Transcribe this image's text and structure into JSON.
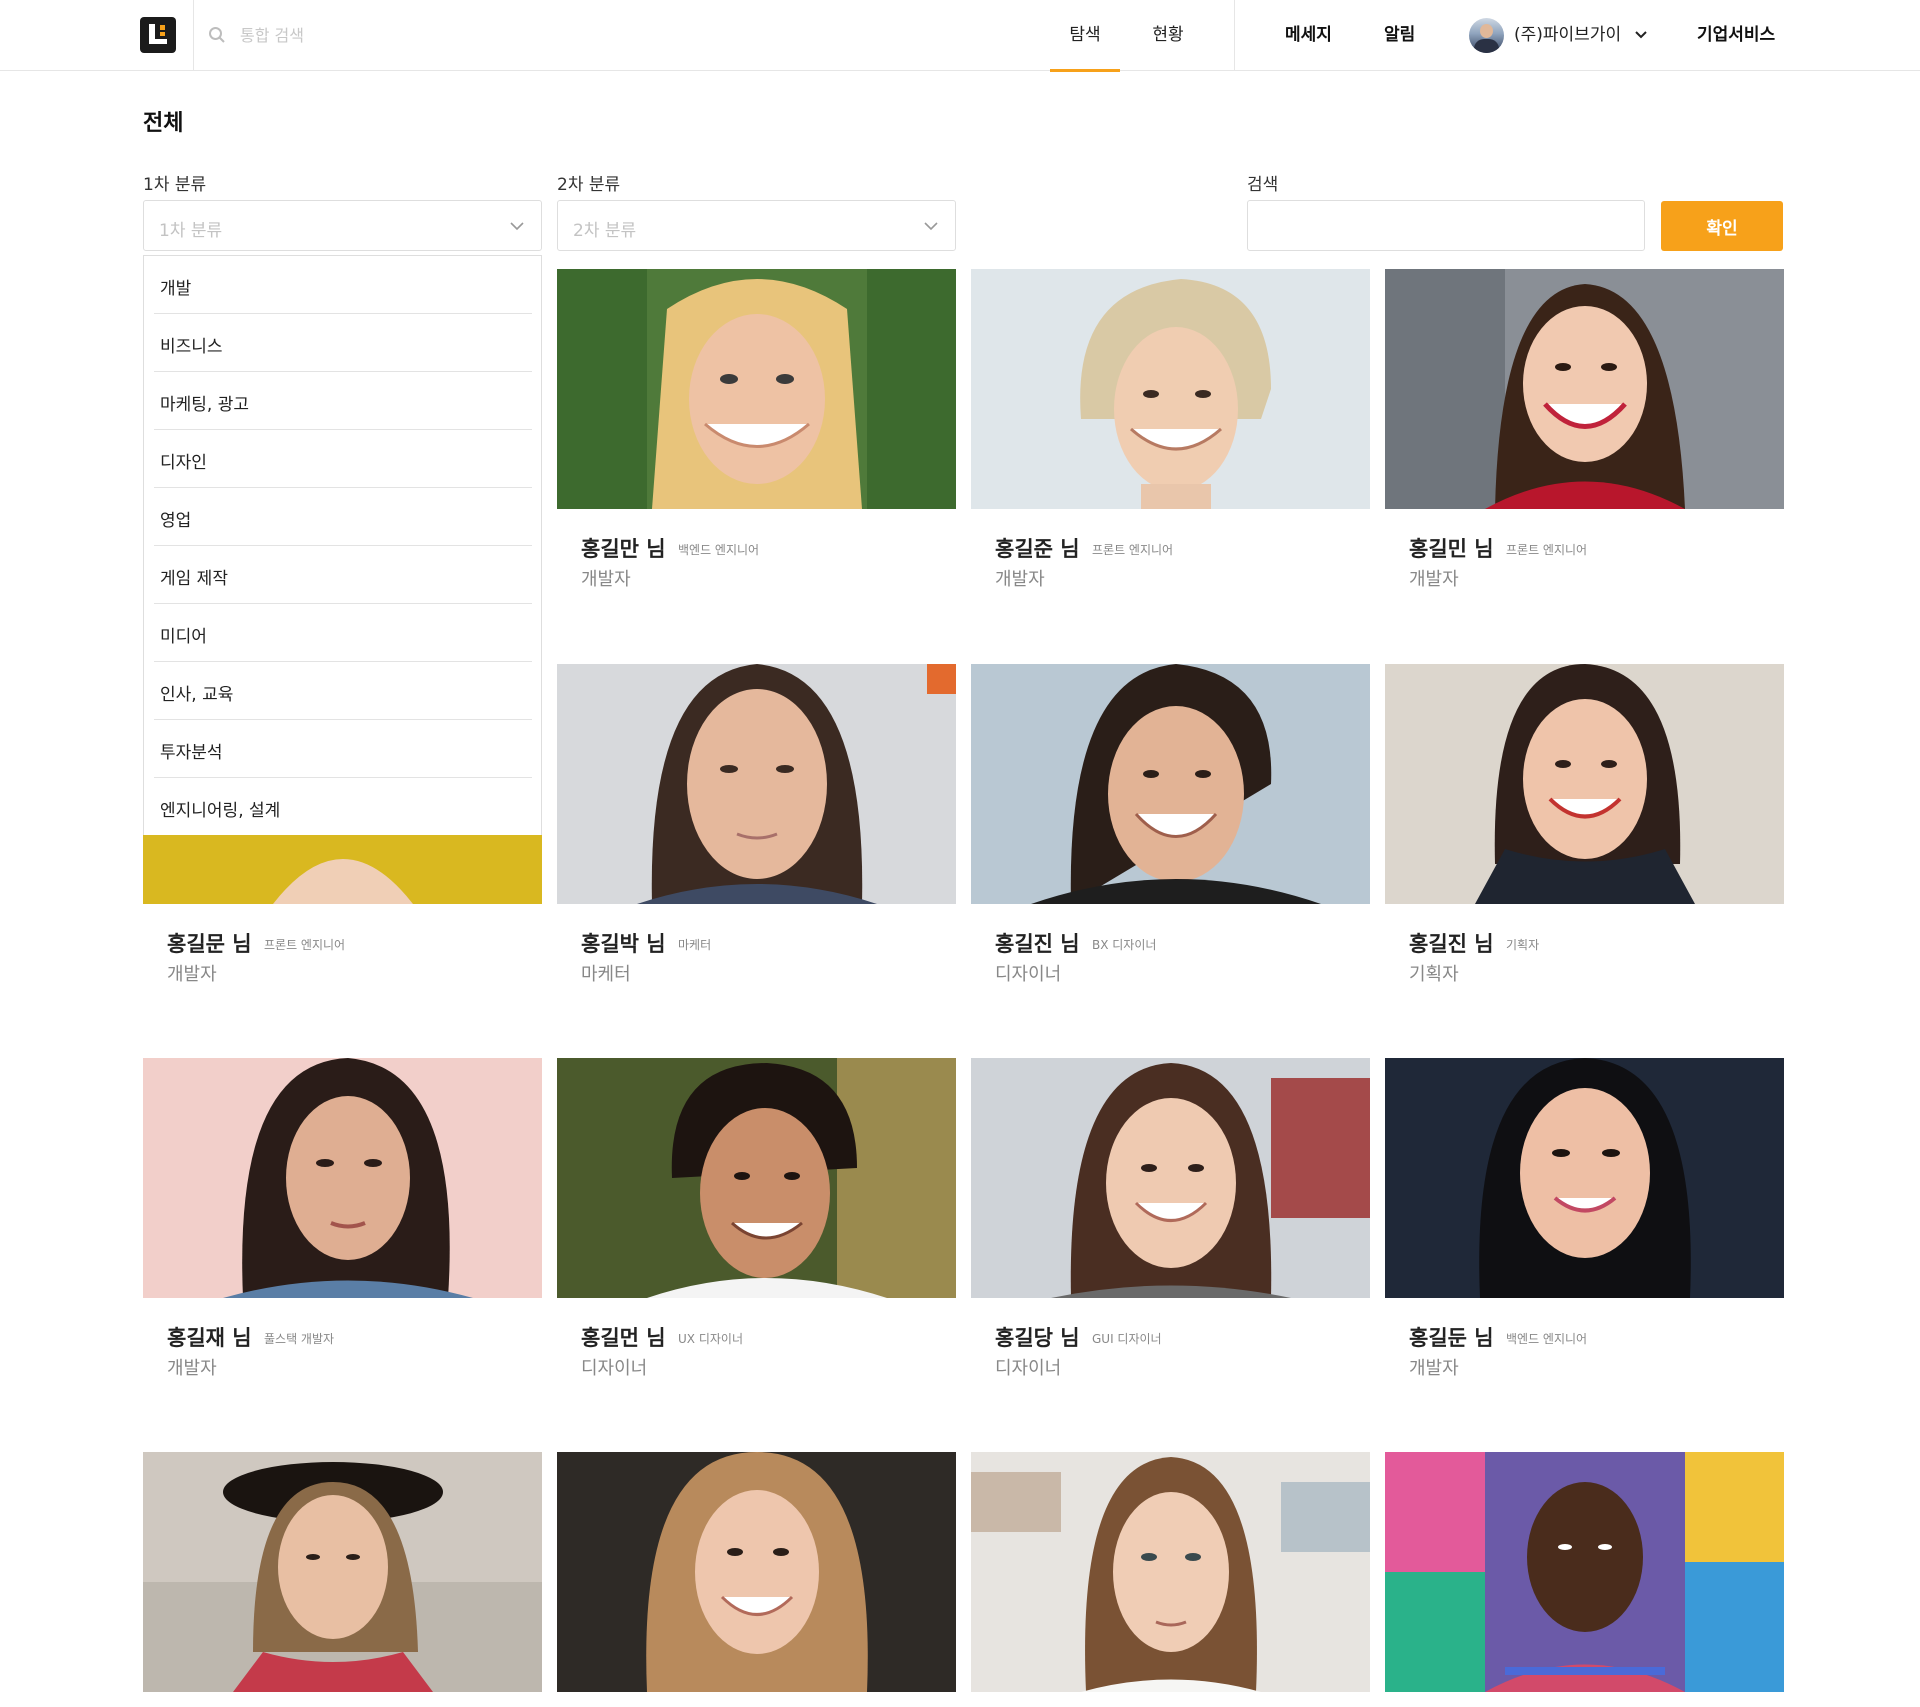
{
  "header": {
    "search_placeholder": "통합 검색",
    "tabs": [
      {
        "label": "탐색",
        "active": true
      },
      {
        "label": "현황",
        "active": false
      }
    ],
    "message_label": "메세지",
    "alarm_label": "알림",
    "company_name": "(주)파이브가이",
    "enterprise_label": "기업서비스",
    "accent_color": "#f7a11a"
  },
  "main": {
    "page_title": "전체",
    "filters": {
      "category1_label": "1차 분류",
      "category1_placeholder": "1차 분류",
      "category2_label": "2차 분류",
      "category2_placeholder": "2차 분류",
      "search_label": "검색",
      "search_value": "",
      "confirm_label": "확인"
    },
    "dropdown_items": [
      "개발",
      "비즈니스",
      "마케팅, 광고",
      "디자인",
      "영업",
      "게임 제작",
      "미디어",
      "인사, 교육",
      "투자분석",
      "엔지니어링, 설계"
    ],
    "cards": [
      {
        "name": "홍길만 님",
        "title": "백엔드 엔지니어",
        "role": "개발자"
      },
      {
        "name": "홍길준 님",
        "title": "프론트 엔지니어",
        "role": "개발자"
      },
      {
        "name": "홍길민 님",
        "title": "프론트 엔지니어",
        "role": "개발자"
      },
      {
        "name": "홍길문 님",
        "title": "프론트 엔지니어",
        "role": "개발자"
      },
      {
        "name": "홍길박 님",
        "title": "마케터",
        "role": "마케터"
      },
      {
        "name": "홍길진 님",
        "title": "BX 디자이너",
        "role": "디자이너"
      },
      {
        "name": "홍길진 님",
        "title": "기획자",
        "role": "기획자"
      },
      {
        "name": "홍길재 님",
        "title": "풀스택 개발자",
        "role": "개발자"
      },
      {
        "name": "홍길먼 님",
        "title": "UX 디자이너",
        "role": "디자이너"
      },
      {
        "name": "홍길당 님",
        "title": "GUI 디자이너",
        "role": "디자이너"
      },
      {
        "name": "홍길둔 님",
        "title": "백엔드 엔지니어",
        "role": "개발자"
      }
    ]
  }
}
